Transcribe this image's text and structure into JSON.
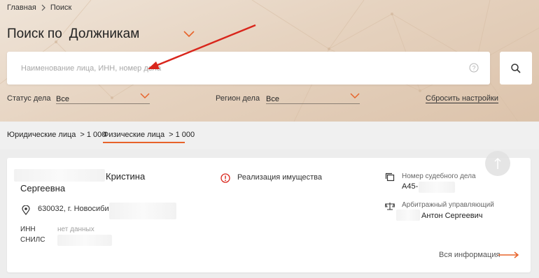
{
  "breadcrumb": {
    "home": "Главная",
    "current": "Поиск"
  },
  "title": {
    "prefix": "Поиск по",
    "selected": "Должникам"
  },
  "search": {
    "placeholder": "Наименование лица, ИНН, номер дела",
    "value": ""
  },
  "filters": {
    "status_label": "Статус дела",
    "status_value": "Все",
    "region_label": "Регион дела",
    "region_value": "Все",
    "reset_label": "Сбросить настройки"
  },
  "tabs": [
    {
      "label": "Юридические лица",
      "count": "> 1 000",
      "active": false
    },
    {
      "label": "Физические лица",
      "count": "> 1 000",
      "active": true
    }
  ],
  "result": {
    "name_visible": "Кристина",
    "name_line2": "Сергеевна",
    "address": "630032, г. Новосибирск",
    "inn_label": "ИНН",
    "inn_value": "нет данных",
    "snils_label": "СНИЛС",
    "status": "Реализация имущества",
    "case_label": "Номер судебного дела",
    "case_value": "А45-",
    "manager_label": "Арбитражный управляющий",
    "manager_value": "Антон Сергеевич",
    "more_label": "Вся информация"
  },
  "colors": {
    "accent": "#e8632a",
    "annotation_arrow": "#d9261c"
  },
  "icons": [
    "chevron-down-icon",
    "help-icon",
    "search-icon",
    "location-pin-icon",
    "alert-circle-icon",
    "documents-icon",
    "scales-icon",
    "arrow-right-icon",
    "arrow-up-icon"
  ]
}
